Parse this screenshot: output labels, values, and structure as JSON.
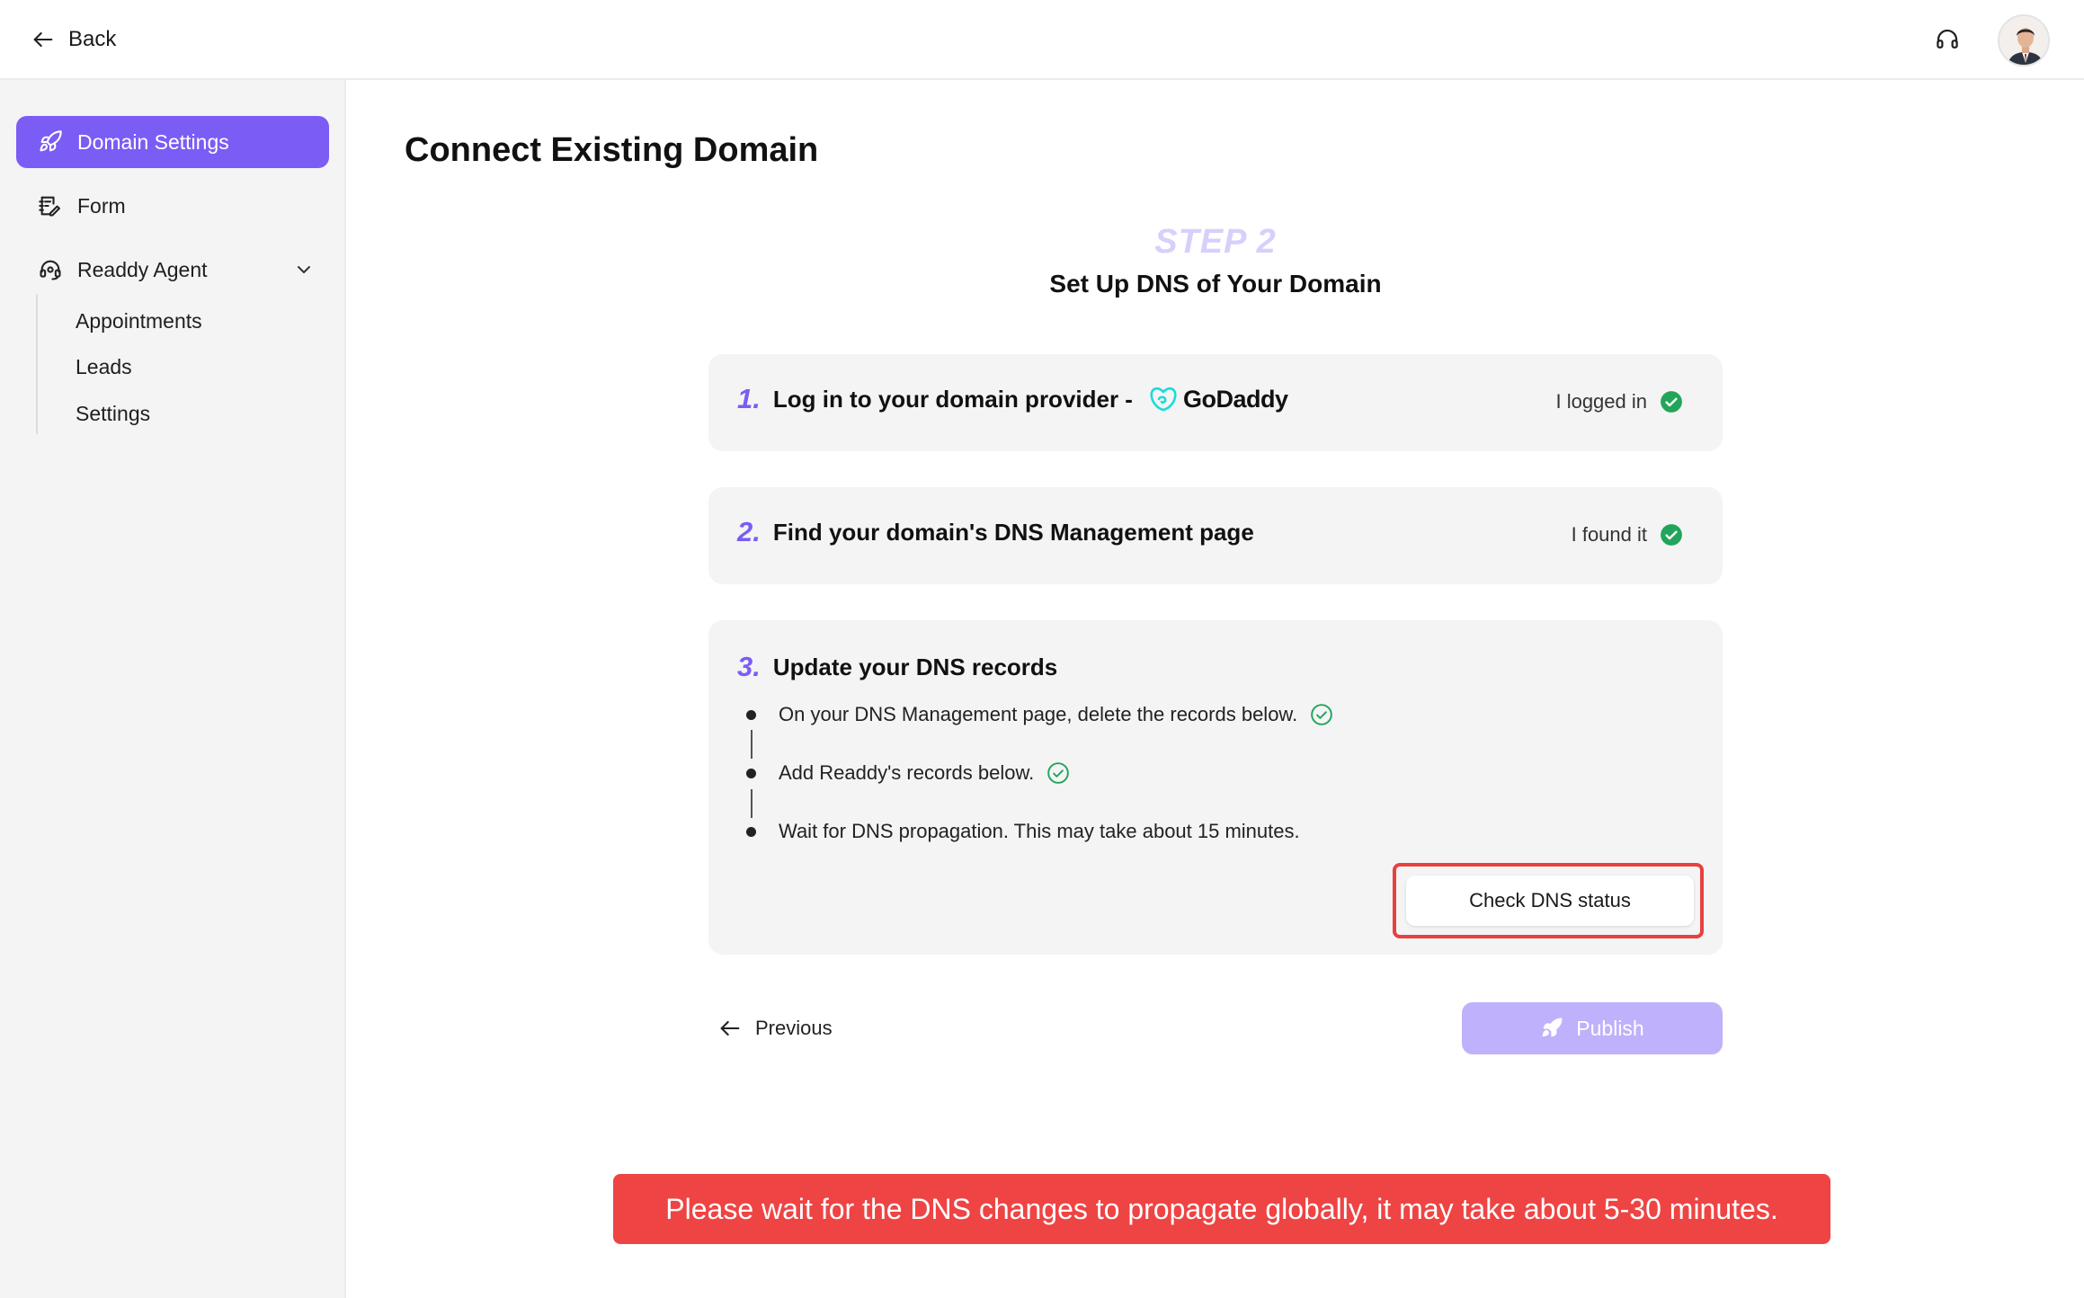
{
  "header": {
    "back_label": "Back",
    "support_icon": "headset-icon",
    "avatar_icon": "user-avatar"
  },
  "sidebar": {
    "items": [
      {
        "label": "Domain Settings",
        "icon": "rocket-icon",
        "active": true
      },
      {
        "label": "Form",
        "icon": "form-edit-icon",
        "active": false
      },
      {
        "label": "Readdy Agent",
        "icon": "agent-headset-icon",
        "active": false,
        "expanded": true
      }
    ],
    "sub_items": [
      {
        "label": "Appointments"
      },
      {
        "label": "Leads"
      },
      {
        "label": "Settings"
      }
    ]
  },
  "main": {
    "title": "Connect Existing Domain",
    "step_label": "STEP 2",
    "step_title": "Set Up DNS of Your Domain",
    "steps": [
      {
        "number": "1.",
        "title": "Log in to your domain provider -",
        "provider": "GoDaddy",
        "status": "I logged in"
      },
      {
        "number": "2.",
        "title": "Find your domain's DNS Management page",
        "status": "I found it"
      },
      {
        "number": "3.",
        "title": "Update your DNS records",
        "bullets": [
          {
            "text": "On your DNS Management page, delete the records below.",
            "done": true
          },
          {
            "text": "Add Readdy's records below.",
            "done": true
          },
          {
            "text": "Wait for DNS propagation. This may take about 15 minutes.",
            "done": false
          }
        ],
        "check_button": "Check DNS status"
      }
    ],
    "previous_label": "Previous",
    "publish_label": "Publish"
  },
  "notice": "Please wait for the DNS changes to propagate globally, it may take about 5-30 minutes.",
  "colors": {
    "accent": "#7b5cf5",
    "accent_light": "#bfb1fb",
    "success": "#22a55a",
    "notice_bg": "#ef4444",
    "highlight": "#e8413f"
  }
}
